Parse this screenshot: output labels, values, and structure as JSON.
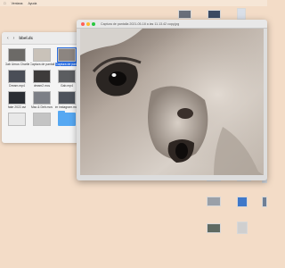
{
  "menubar": {
    "apple_icon": "apple-icon",
    "items": [
      "Ventana",
      "Ayuda"
    ]
  },
  "finder": {
    "title": "bbel.dc",
    "items": [
      {
        "label": "Gab Umus Charlie"
      },
      {
        "label": "Captura de pantalla 17.13.42"
      },
      {
        "label": "Captura de pantalla...11.52.jpeg",
        "selected": true
      },
      {
        "label": "Dream.mp4"
      },
      {
        "label": "dream2.mov"
      },
      {
        "label": "Gab.mp4"
      },
      {
        "label": "fake 2022.avi"
      },
      {
        "label": "Mac & Deb.mov"
      },
      {
        "label": "im instagram.mov"
      },
      {
        "label": ""
      },
      {
        "label": ""
      },
      {
        "label": ""
      }
    ]
  },
  "preview": {
    "title": "Captura de pantalla 2021-05-18 a las 11.13.42 copy.jpg",
    "colors": {
      "close": "#ff5f57",
      "minimize": "#febc2e",
      "zoom": "#28c840"
    }
  }
}
